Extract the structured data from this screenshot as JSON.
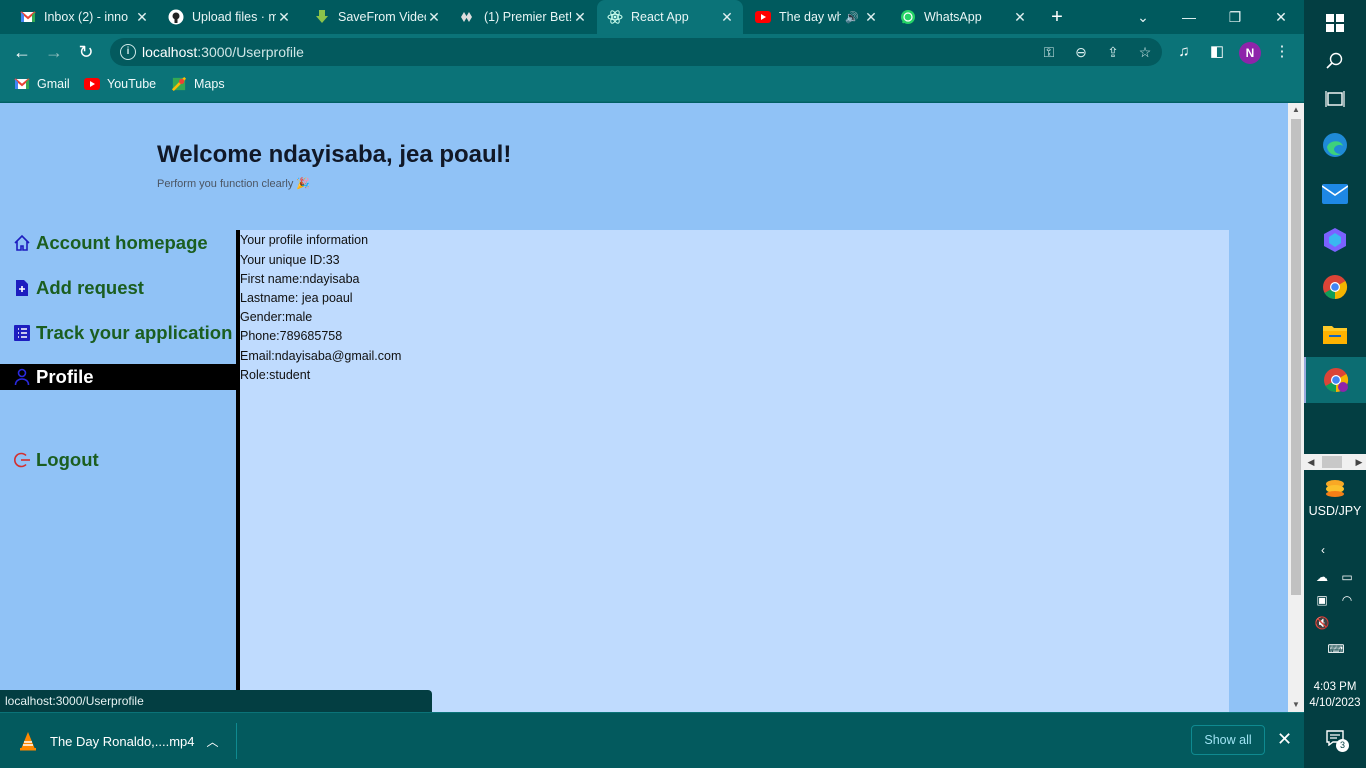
{
  "browser": {
    "tabs": [
      {
        "title": "Inbox (2) - inno",
        "icon": "gmail-icon"
      },
      {
        "title": "Upload files · m",
        "icon": "github-icon"
      },
      {
        "title": "SaveFrom Video",
        "icon": "download-arrow-icon"
      },
      {
        "title": "(1) Premier Bet!",
        "icon": "premierbet-icon"
      },
      {
        "title": "React App",
        "icon": "react-icon",
        "active": true
      },
      {
        "title": "The day wh",
        "icon": "youtube-icon",
        "audio": true
      },
      {
        "title": "WhatsApp",
        "icon": "whatsapp-icon"
      }
    ],
    "new_tab_label": "+",
    "window_controls": {
      "menu": "⌄",
      "minimize": "—",
      "restore": "❐",
      "close": "✕"
    },
    "address_bar": {
      "host": "localhost",
      "path": ":3000/Userprofile"
    },
    "profile_initial": "N",
    "bookmarks": [
      {
        "label": "Gmail",
        "icon": "gmail-icon"
      },
      {
        "label": "YouTube",
        "icon": "youtube-icon"
      },
      {
        "label": "Maps",
        "icon": "maps-icon"
      }
    ],
    "status_url": "localhost:3000/Userprofile"
  },
  "page": {
    "welcome": "Welcome ndayisaba, jea poaul!",
    "subtitle": "Perform you function clearly",
    "subtitle_emoji": "🎉",
    "nav": [
      {
        "label": "Account homepage",
        "icon": "home-icon"
      },
      {
        "label": "Add request",
        "icon": "add-document-icon"
      },
      {
        "label": "Track your application",
        "icon": "list-icon"
      },
      {
        "label": "Profile",
        "icon": "user-icon",
        "active": true
      },
      {
        "label": "Logout",
        "icon": "logout-icon"
      }
    ],
    "profile": {
      "heading": "Your profile information",
      "lines": [
        "Your unique ID:33",
        "First name:ndayisaba",
        "Lastname: jea poaul",
        "Gender:male",
        "Phone:789685758",
        "Email:ndayisaba@gmail.com",
        "Role:student"
      ]
    }
  },
  "downloads": {
    "file": "The Day Ronaldo,....mp4",
    "show_all": "Show all"
  },
  "taskbar": {
    "widget_label": "USD/JPY",
    "time": "4:03 PM",
    "date": "4/10/2023",
    "notification_count": "3"
  },
  "colors": {
    "page_bg": "#90c2f6",
    "panel_bg": "#bfdbfe",
    "nav_text": "#1b5e20",
    "chrome_bg": "#006064",
    "taskbar_bg": "#033e42"
  }
}
